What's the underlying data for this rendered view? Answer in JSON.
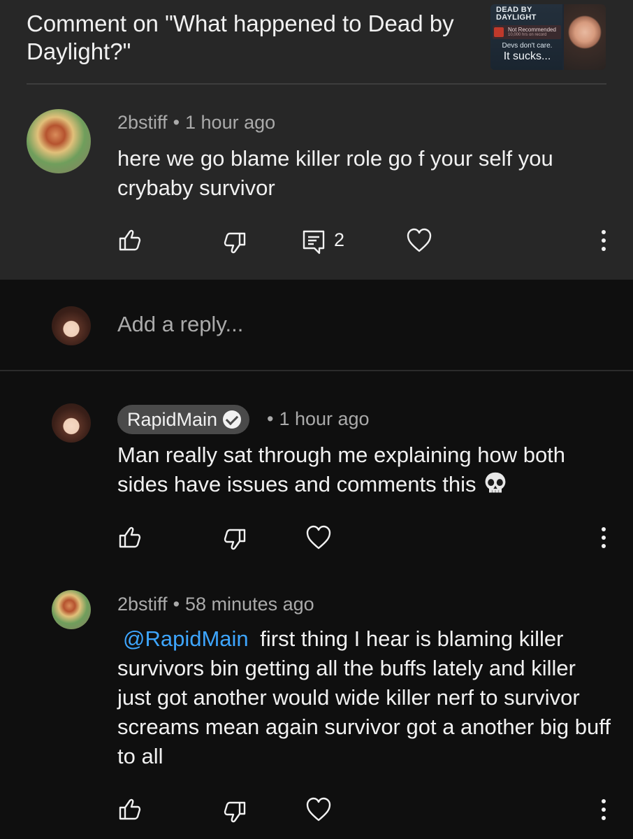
{
  "header": {
    "title": "Comment on \"What happened to Dead by Daylight?\"",
    "thumbnail": {
      "logo_line1": "DEAD BY",
      "logo_line2": "DAYLIGHT",
      "badge": "Not Recommended",
      "badge_sub": "10,000 hrs on record",
      "caption_small": "Devs don't care.",
      "caption_large": "It sucks..."
    }
  },
  "parent_comment": {
    "author": "2bstiff",
    "time": "1 hour ago",
    "text": "here we go blame killer role go f your self you crybaby survivor",
    "reply_count": "2"
  },
  "reply_box": {
    "placeholder": "Add a reply..."
  },
  "replies": [
    {
      "author": "RapidMain",
      "verified": true,
      "time": "1 hour ago",
      "text": "Man really sat through me explaining how both sides have issues and comments this"
    },
    {
      "author": "2bstiff",
      "time": "58 minutes ago",
      "mention": "@RapidMain",
      "text": "first thing I hear is blaming killer survivors bin getting all the buffs lately and killer just got another would wide killer nerf to survivor screams mean again survivor got a another big buff to all"
    }
  ],
  "separator": "•",
  "colors": {
    "header_bg": "#272727",
    "page_bg": "#0f0f0f",
    "text_primary": "#f1f1f1",
    "text_secondary": "#aaaaaa",
    "mention": "#3ea6ff",
    "owner_chip": "#4a4a4a"
  },
  "icons": [
    "like-icon",
    "dislike-icon",
    "replies-icon",
    "heart-icon",
    "more-icon",
    "verified-icon",
    "skull-emoji"
  ]
}
